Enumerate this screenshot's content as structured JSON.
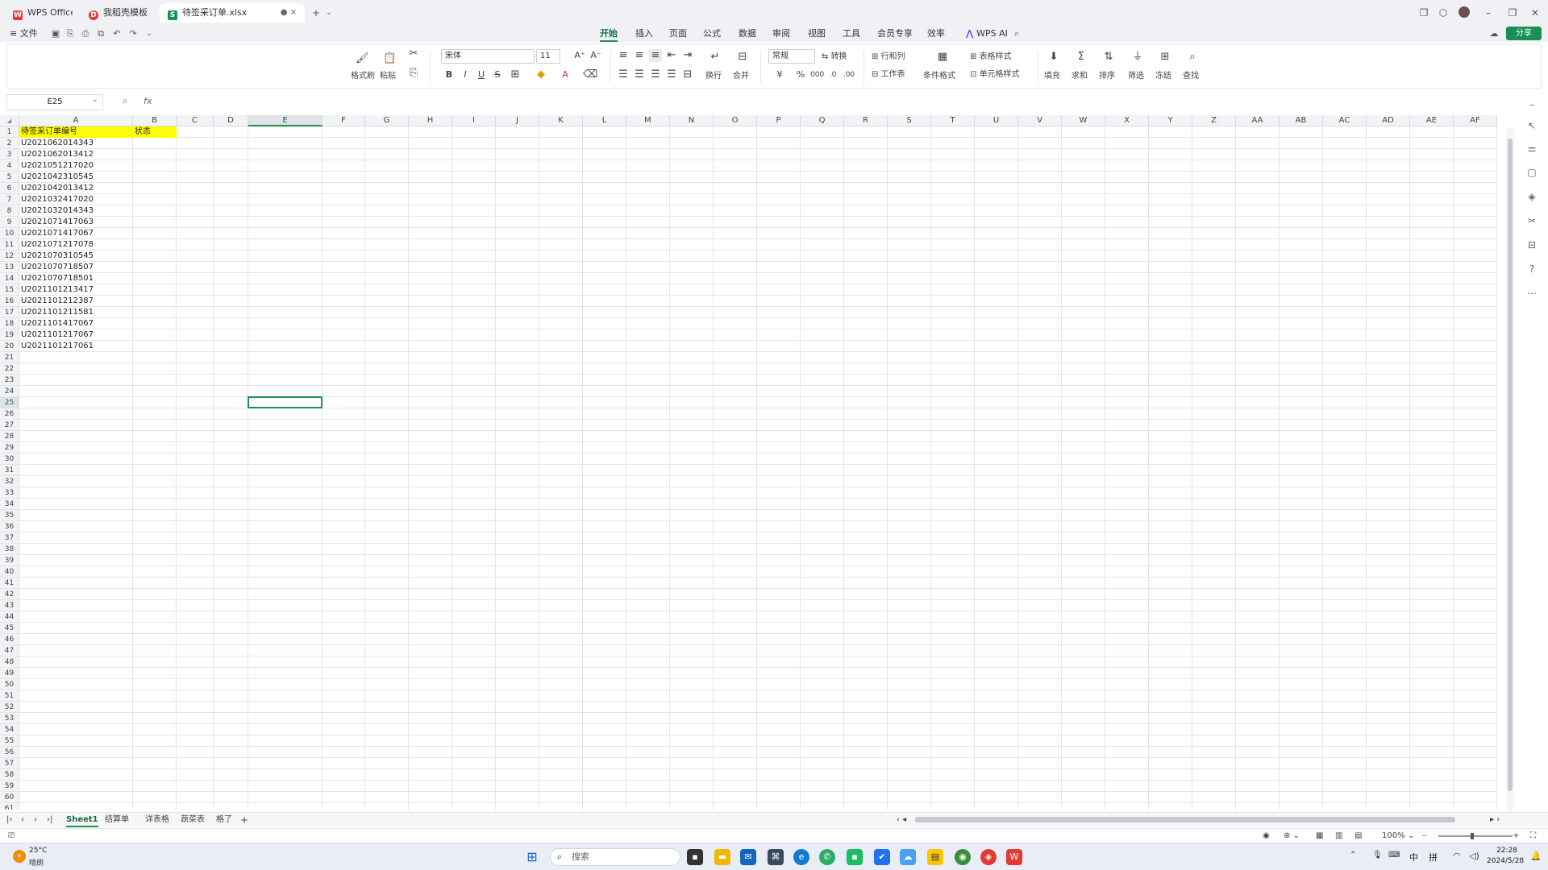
{
  "window": {
    "tabs": [
      {
        "label": "WPS Office",
        "icon": "wps-logo-icon",
        "color": "#e53935"
      },
      {
        "label": "我稻壳模板",
        "icon": "docer-icon",
        "color": "#e53935"
      },
      {
        "label": "待签采订单.xlsx",
        "icon": "spreadsheet-icon",
        "color": "#1a8f53"
      }
    ],
    "new_tab_label": "+"
  },
  "menu": {
    "file_label": "≡ 文件",
    "tabs": [
      "开始",
      "插入",
      "页面",
      "公式",
      "数据",
      "审阅",
      "视图",
      "工具",
      "会员专享",
      "效率"
    ],
    "active_tab": "开始",
    "wps_ai_label": "WPS AI",
    "share_label": "分享"
  },
  "ribbon": {
    "format_painter": "格式刷",
    "paste": "粘贴",
    "font_name": "宋体",
    "font_size": "11",
    "wrap": "换行",
    "merge": "合并",
    "number_format": "常规",
    "convert": "转换",
    "rowcol": "行和列",
    "worksheet": "工作表",
    "cond_format": "条件格式",
    "table_style": "表格样式",
    "cell_style": "单元格样式",
    "fill": "填充",
    "sum": "求和",
    "sort": "排序",
    "filter": "筛选",
    "freeze": "冻结",
    "find": "查找"
  },
  "formula_bar": {
    "name_box": "E25",
    "fx_label": "fx",
    "value": ""
  },
  "sheet": {
    "columns": [
      "A",
      "B",
      "C",
      "D",
      "E",
      "F",
      "G",
      "H",
      "I",
      "J",
      "K",
      "L",
      "M",
      "N",
      "O",
      "P",
      "Q",
      "R",
      "S",
      "T",
      "U",
      "V",
      "W",
      "X",
      "Y",
      "Z",
      "AA",
      "AB",
      "AC",
      "AD",
      "AE",
      "AF"
    ],
    "selected_column": "E",
    "selected_row": 25,
    "row_count": 61,
    "header_row": {
      "a": "待签采订单编号",
      "b": "状态"
    },
    "header_highlight": "#ffff00",
    "order_numbers": [
      "U2021062014343",
      "U2021062013412",
      "U2021051217020",
      "U2021042310545",
      "U2021042013412",
      "U2021032417020",
      "U2021032014343",
      "U2021071417063",
      "U2021071417067",
      "U2021071217078",
      "U2021070310545",
      "U2021070718507",
      "U2021070718501",
      "U2021101213417",
      "U2021101212387",
      "U2021101211581",
      "U2021101417067",
      "U2021101217067",
      "U2021101217061"
    ]
  },
  "sheet_tabs": [
    "Sheet1",
    "结算单",
    "详表格",
    "蔬菜表",
    "格了"
  ],
  "active_sheet": "Sheet1",
  "status": {
    "zoom": "100%"
  },
  "taskbar": {
    "weather_temp": "25°C",
    "weather_desc": "晴朗",
    "search_placeholder": "搜索",
    "time": "22:28",
    "date": "2024/5/28",
    "ime": "中",
    "ime2": "拼"
  },
  "colors": {
    "accent": "#1a8f53",
    "header_fill": "#ffff00"
  }
}
